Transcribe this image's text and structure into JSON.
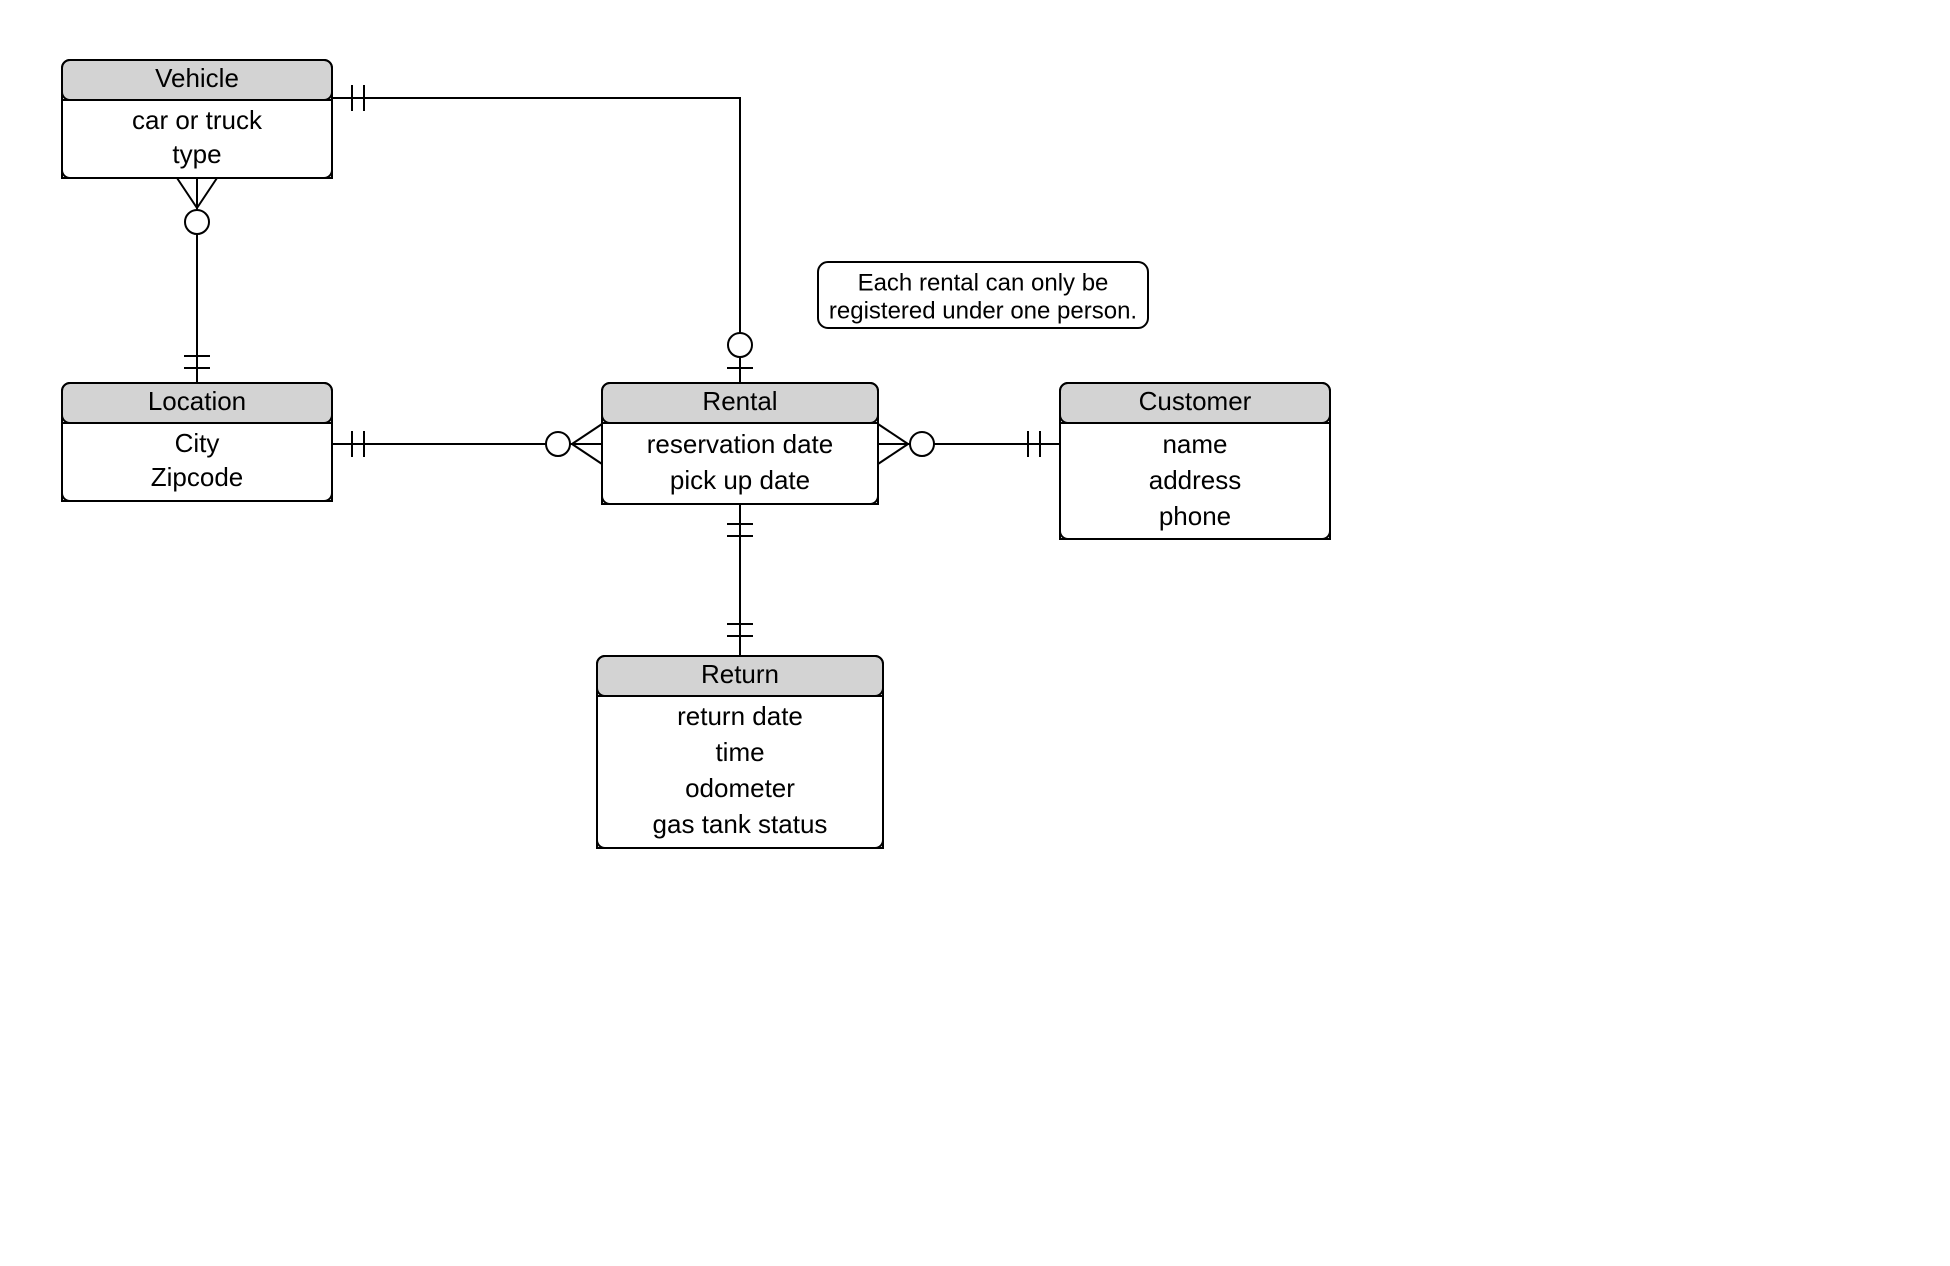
{
  "entities": {
    "vehicle": {
      "title": "Vehicle",
      "attrs": [
        "car or truck",
        "type"
      ]
    },
    "location": {
      "title": "Location",
      "attrs": [
        "City",
        "Zipcode"
      ]
    },
    "rental": {
      "title": "Rental",
      "attrs": [
        "reservation date",
        "pick up date"
      ]
    },
    "customer": {
      "title": "Customer",
      "attrs": [
        "name",
        "address",
        "phone"
      ]
    },
    "return": {
      "title": "Return",
      "attrs": [
        "return date",
        "time",
        "odometer",
        "gas tank status"
      ]
    }
  },
  "note": {
    "line1": "Each rental can only be",
    "line2": "registered under one person."
  }
}
